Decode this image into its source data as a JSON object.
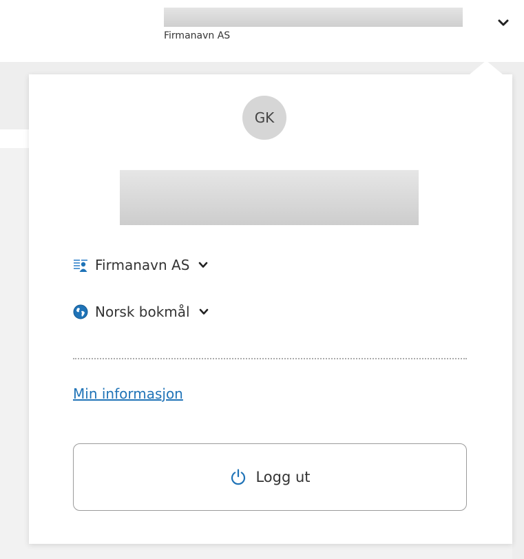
{
  "header": {
    "company_name": "Firmanavn AS",
    "menu_toggle_icon": "chevron-down-icon"
  },
  "profile": {
    "initials": "GK",
    "avatar_color": "#d6d6d6"
  },
  "company_selector": {
    "label": "Firmanavn AS",
    "icon": "organization-icon"
  },
  "language_selector": {
    "label": "Norsk bokmål",
    "icon": "globe-icon"
  },
  "links": {
    "my_info": "Min informasjon"
  },
  "logout": {
    "label": "Logg ut",
    "icon": "power-icon"
  },
  "colors": {
    "accent": "#1f73b7",
    "text": "#333333"
  }
}
